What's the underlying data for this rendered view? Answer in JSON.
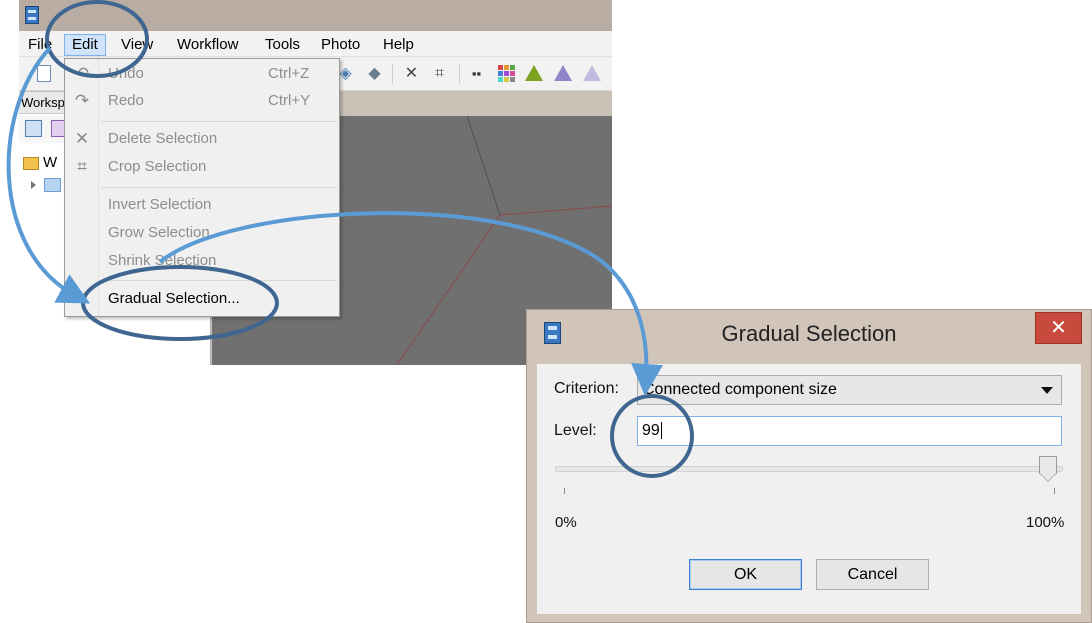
{
  "menubar": {
    "items": [
      {
        "label": "File"
      },
      {
        "label": "Edit"
      },
      {
        "label": "View"
      },
      {
        "label": "Workflow"
      },
      {
        "label": "Tools"
      },
      {
        "label": "Photo"
      },
      {
        "label": "Help"
      }
    ],
    "active_item": "Edit"
  },
  "toolbar": {
    "icons": [
      "new-document-icon",
      "move-tool-icon",
      "rotate-tool-icon",
      "delete-icon",
      "crop-icon",
      "grid-view-icon",
      "color-grid-icon",
      "shaded-model-icon",
      "solid-model-icon",
      "wireframe-model-icon"
    ]
  },
  "workspace": {
    "tab_label": "Worksp",
    "tree": [
      {
        "label": "W",
        "icon": "folder-icon"
      },
      {
        "label": "",
        "icon": "chunk-icon"
      }
    ]
  },
  "edit_menu": {
    "items": [
      {
        "label": "Undo",
        "shortcut": "Ctrl+Z",
        "icon": "undo-icon",
        "enabled": false
      },
      {
        "label": "Redo",
        "shortcut": "Ctrl+Y",
        "icon": "redo-icon",
        "enabled": false
      },
      {
        "label": "Delete Selection",
        "shortcut": "",
        "icon": "delete-icon",
        "enabled": false
      },
      {
        "label": "Crop Selection",
        "shortcut": "",
        "icon": "crop-icon",
        "enabled": false
      },
      {
        "label": "Invert Selection",
        "shortcut": "",
        "icon": "",
        "enabled": false
      },
      {
        "label": "Grow Selection",
        "shortcut": "",
        "icon": "",
        "enabled": false
      },
      {
        "label": "Shrink Selection",
        "shortcut": "",
        "icon": "",
        "enabled": false
      },
      {
        "label": "Gradual Selection...",
        "shortcut": "",
        "icon": "",
        "enabled": true
      }
    ]
  },
  "dialog": {
    "title": "Gradual Selection",
    "close_glyph": "✕",
    "criterion_label": "Criterion:",
    "criterion_value": "Connected component size",
    "level_label": "Level:",
    "level_value": "99",
    "slider_value_percent": 99,
    "slider_min_label": "0%",
    "slider_max_label": "100%",
    "ok_label": "OK",
    "cancel_label": "Cancel"
  },
  "colors": {
    "annotation_arrow": "#5b9bd5",
    "annotation_circle": "#3e6690",
    "menu_highlight": "#cfe4fb",
    "close_button": "#c74a3c",
    "viewport": "#707070"
  }
}
